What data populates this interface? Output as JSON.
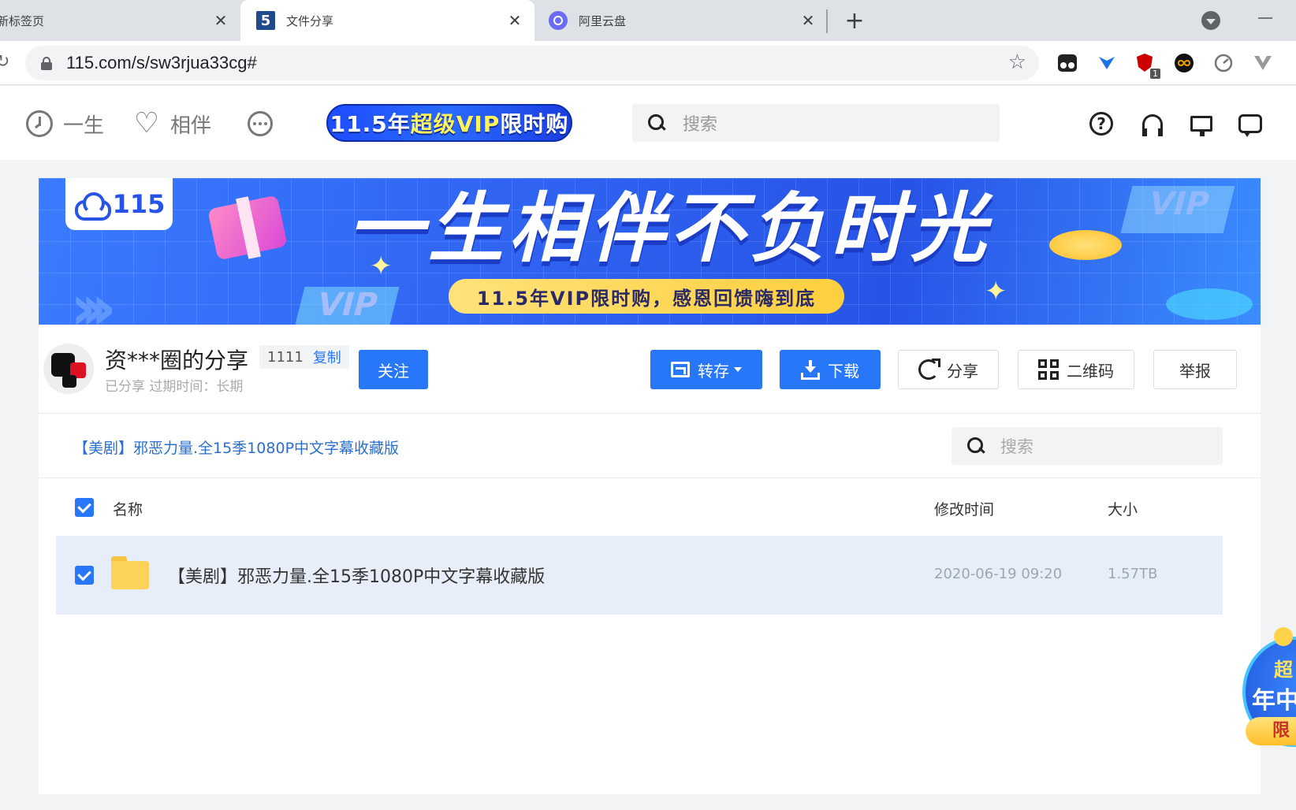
{
  "browser": {
    "tabs": [
      {
        "title": "新标签页"
      },
      {
        "title": "文件分享",
        "favicon": "5"
      },
      {
        "title": "阿里云盘"
      }
    ],
    "close_glyph": "✕",
    "new_tab_glyph": "+",
    "url": "115.com/s/sw3rjua33cg#",
    "extension_badge": "1"
  },
  "header": {
    "nav": [
      {
        "label": "一生",
        "icon": "clock-icon"
      },
      {
        "label": "相伴",
        "icon": "heart-icon"
      },
      {
        "label": "",
        "icon": "more-icon"
      }
    ],
    "vip_banner_a": "11.5年",
    "vip_banner_b": "超级VIP",
    "vip_banner_c": "限时购",
    "search_placeholder": "搜索"
  },
  "promo": {
    "logo_text": "115",
    "title": "一生相伴不负时光",
    "subtitle": "11.5年VIP限时购，感恩回馈嗨到底",
    "card_text": "VIP"
  },
  "share": {
    "owner_name": "资***圈的分享",
    "owner_id": "1111",
    "copy_label": "复制",
    "meta": "已分享 过期时间：长期",
    "follow_label": "关注",
    "actions": {
      "save": "转存",
      "download": "下载",
      "share": "分享",
      "qrcode": "二维码",
      "report": "举报"
    },
    "breadcrumb": "【美剧】邪恶力量.全15季1080P中文字幕收藏版",
    "search_placeholder": "搜索",
    "columns": {
      "name": "名称",
      "modified": "修改时间",
      "size": "大小"
    },
    "files": [
      {
        "name": "【美剧】邪恶力量.全15季1080P中文字幕收藏版",
        "modified": "2020-06-19 09:20",
        "size": "1.57TB",
        "type": "folder",
        "checked": true
      }
    ]
  },
  "float_promo": {
    "line1": "超",
    "line2": "年中",
    "line3": "限"
  },
  "colors": {
    "accent": "#2777f8",
    "selected_row": "#e8eef9",
    "folder": "#fbd35a"
  }
}
